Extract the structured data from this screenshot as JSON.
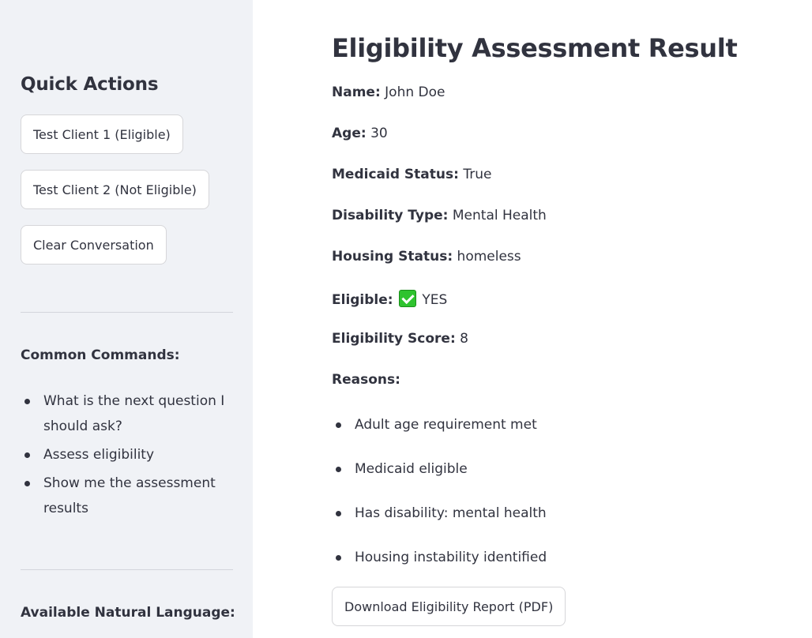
{
  "sidebar": {
    "heading": "Quick Actions",
    "buttons": [
      "Test Client 1 (Eligible)",
      "Test Client 2 (Not Eligible)",
      "Clear Conversation"
    ],
    "common_commands": {
      "heading": "Common Commands:",
      "items": [
        "What is the next question I should ask?",
        "Assess eligibility",
        "Show me the assessment results"
      ]
    },
    "natural_language": {
      "heading": "Available Natural Language:"
    }
  },
  "main": {
    "title": "Eligibility Assessment Result",
    "fields": [
      {
        "label": "Name:",
        "value": "John Doe"
      },
      {
        "label": "Age:",
        "value": "30"
      },
      {
        "label": "Medicaid Status:",
        "value": "True"
      },
      {
        "label": "Disability Type:",
        "value": "Mental Health"
      },
      {
        "label": "Housing Status:",
        "value": "homeless"
      },
      {
        "label": "Eligible:",
        "value": "YES",
        "icon": "check-mark-icon"
      },
      {
        "label": "Eligibility Score:",
        "value": "8"
      }
    ],
    "reasons_label": "Reasons:",
    "reasons": [
      "Adult age requirement met",
      "Medicaid eligible",
      "Has disability: mental health",
      "Housing instability identified"
    ],
    "download_button": "Download Eligibility Report (PDF)"
  }
}
